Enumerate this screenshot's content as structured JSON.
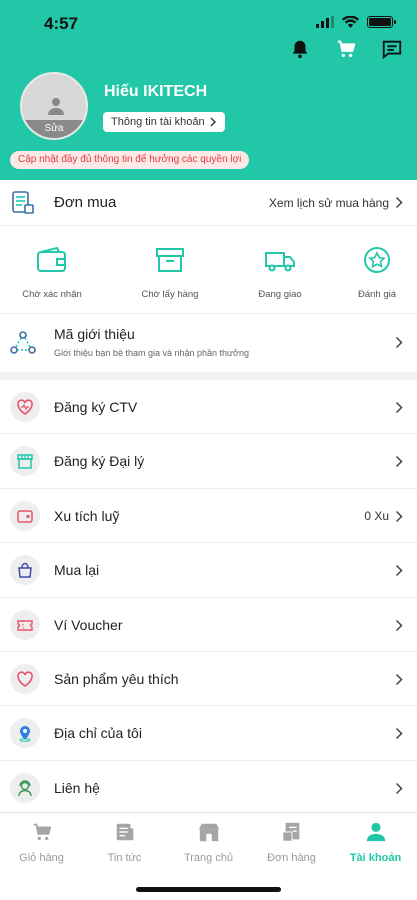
{
  "status_bar": {
    "time": "4:57"
  },
  "profile": {
    "edit_label": "Sửa",
    "name": "Hiếu IKITECH",
    "account_info_label": "Thông tin tài khoản",
    "update_notice": "Cập nhật đầy đủ thông tin để hưởng các quyền lợi"
  },
  "orders": {
    "title": "Đơn mua",
    "history_link": "Xem lịch sử mua hàng",
    "statuses": [
      {
        "label": "Chờ xác nhận",
        "icon": "wallet-icon"
      },
      {
        "label": "Chờ lấy hàng",
        "icon": "box-icon"
      },
      {
        "label": "Đang giao",
        "icon": "truck-icon"
      },
      {
        "label": "Đánh giá",
        "icon": "star-icon"
      }
    ]
  },
  "referral": {
    "title": "Mã giới thiệu",
    "subtitle": "Giới thiệu bạn bè tham gia và nhận phần thưởng"
  },
  "menu": [
    {
      "label": "Đăng ký CTV",
      "icon": "heart-register-icon",
      "value": ""
    },
    {
      "label": "Đăng ký Đại lý",
      "icon": "store-icon",
      "value": ""
    },
    {
      "label": "Xu tích luỹ",
      "icon": "coin-wallet-icon",
      "value": "0 Xu"
    },
    {
      "label": "Mua lại",
      "icon": "bag-icon",
      "value": ""
    },
    {
      "label": "Ví Voucher",
      "icon": "voucher-icon",
      "value": ""
    },
    {
      "label": "Sản phẩm yêu thích",
      "icon": "heart-icon",
      "value": ""
    },
    {
      "label": "Địa chỉ của tôi",
      "icon": "location-pin-icon",
      "value": ""
    },
    {
      "label": "Liên hệ",
      "icon": "support-agent-icon",
      "value": ""
    }
  ],
  "bottom_nav": [
    {
      "label": "Giỏ hàng",
      "icon": "cart-icon",
      "active": false
    },
    {
      "label": "Tin tức",
      "icon": "news-icon",
      "active": false
    },
    {
      "label": "Trang chủ",
      "icon": "shop-icon",
      "active": false
    },
    {
      "label": "Đơn hàng",
      "icon": "orders-icon",
      "active": false
    },
    {
      "label": "Tài khoản",
      "icon": "account-icon",
      "active": true
    }
  ],
  "colors": {
    "brand": "#22c7a8",
    "warning": "#e53a3a"
  }
}
